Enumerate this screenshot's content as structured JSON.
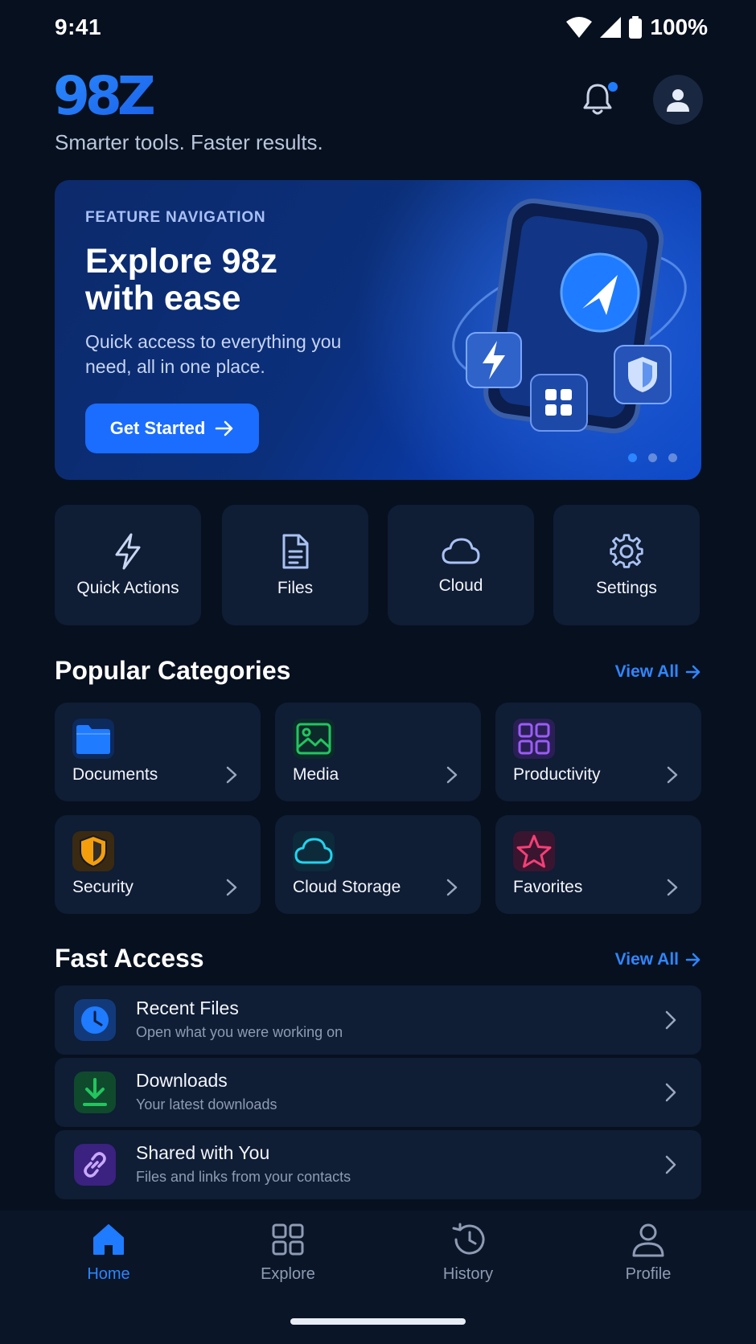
{
  "status_bar": {
    "time": "9:41",
    "battery": "100%"
  },
  "header": {
    "logo": "98Z",
    "tagline": "Smarter tools. Faster results."
  },
  "hero": {
    "kicker": "FEATURE NAVIGATION",
    "title": "Explore 98z with ease",
    "subtitle": "Quick access to everything you need, all in one place.",
    "button": "Get Started",
    "carousel_active_index": 0,
    "carousel_count": 3
  },
  "quick_tiles": [
    {
      "label": "Quick Actions",
      "icon": "lightning-icon"
    },
    {
      "label": "Files",
      "icon": "document-icon"
    },
    {
      "label": "Cloud",
      "icon": "cloud-icon"
    },
    {
      "label": "Settings",
      "icon": "gear-icon"
    }
  ],
  "categories": {
    "title": "Popular Categories",
    "view_all": "View All",
    "items": [
      {
        "label": "Documents",
        "icon": "folder-icon",
        "color": "#1f7bff"
      },
      {
        "label": "Media",
        "icon": "image-icon",
        "color": "#22c55e"
      },
      {
        "label": "Productivity",
        "icon": "grid-icon",
        "color": "#9b5cf6"
      },
      {
        "label": "Security",
        "icon": "shield-icon",
        "color": "#f59e0b"
      },
      {
        "label": "Cloud Storage",
        "icon": "cloud-icon",
        "color": "#22d3ee"
      },
      {
        "label": "Favorites",
        "icon": "star-icon",
        "color": "#f43f75"
      }
    ]
  },
  "fast_access": {
    "title": "Fast Access",
    "view_all": "View All",
    "items": [
      {
        "title": "Recent Files",
        "subtitle": "Open what you were working on",
        "icon": "clock-icon",
        "color": "#1f7bff"
      },
      {
        "title": "Downloads",
        "subtitle": "Your latest downloads",
        "icon": "download-icon",
        "color": "#22c55e"
      },
      {
        "title": "Shared with You",
        "subtitle": "Files and links from your contacts",
        "icon": "link-icon",
        "color": "#9b5cf6"
      }
    ]
  },
  "bottom_nav": {
    "active": "Home",
    "items": [
      {
        "label": "Home",
        "icon": "home-icon"
      },
      {
        "label": "Explore",
        "icon": "grid-icon"
      },
      {
        "label": "History",
        "icon": "history-icon"
      },
      {
        "label": "Profile",
        "icon": "user-icon"
      }
    ]
  },
  "colors": {
    "accent": "#1f7bff",
    "background": "#07101f",
    "card": "#0f1d35"
  }
}
